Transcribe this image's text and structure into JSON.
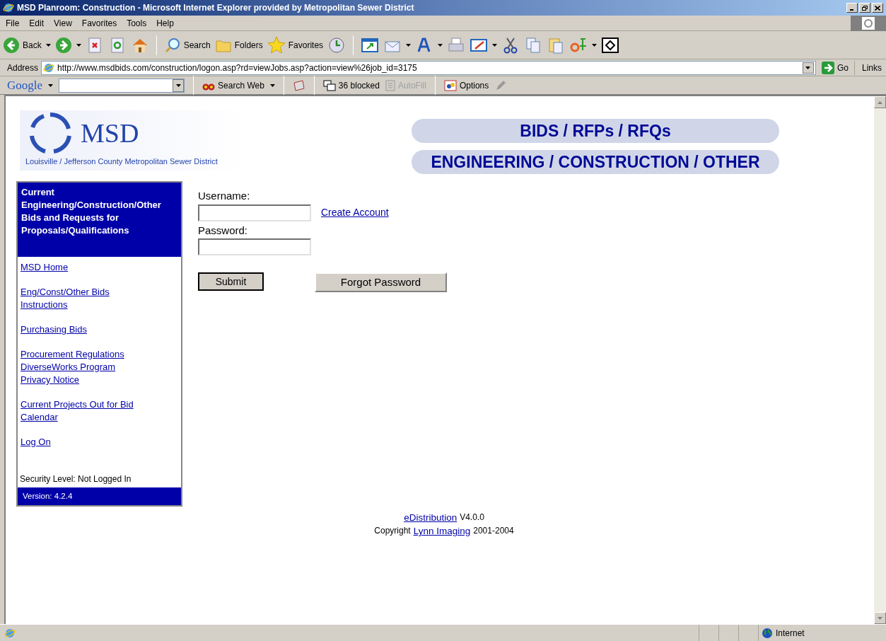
{
  "window": {
    "title": "MSD Planroom: Construction - Microsoft Internet Explorer provided by Metropolitan Sewer District"
  },
  "menu": [
    "File",
    "Edit",
    "View",
    "Favorites",
    "Tools",
    "Help"
  ],
  "toolbar": {
    "back": "Back",
    "search": "Search",
    "folders": "Folders",
    "favorites": "Favorites"
  },
  "address_bar": {
    "label": "Address",
    "url": "http://www.msdbids.com/construction/logon.asp?rd=viewJobs.asp?action=view%26job_id=3175",
    "go": "Go",
    "links": "Links"
  },
  "google_bar": {
    "logo": "Google",
    "search_web": "Search Web",
    "blocked": "36 blocked",
    "autofill": {
      "label": "AutoFill",
      "disabled": true
    },
    "options": "Options"
  },
  "page": {
    "logo": {
      "name": "MSD",
      "subtitle": "Louisville / Jefferson County Metropolitan Sewer District"
    },
    "banner": [
      "BIDS / RFPs / RFQs",
      "ENGINEERING / CONSTRUCTION / OTHER"
    ],
    "sidebar": {
      "heading": "Current Engineering/Construction/Other Bids and Requests for Proposals/Qualifications",
      "link_groups": [
        [
          "MSD Home"
        ],
        [
          "Eng/Const/Other Bids Instructions"
        ],
        [
          "Purchasing Bids"
        ],
        [
          "Procurement Regulations",
          "DiverseWorks Program",
          "Privacy Notice"
        ],
        [
          "Current Projects Out for Bid Calendar"
        ],
        [
          "Log On"
        ]
      ],
      "security": "Security Level: Not Logged In",
      "version": "Version: 4.2.4"
    },
    "form": {
      "username_label": "Username:",
      "password_label": "Password:",
      "create_account": "Create Account",
      "submit": "Submit",
      "forgot_password": "Forgot Password"
    },
    "footer": {
      "product_link": "eDistribution",
      "product_version": "V4.0.0",
      "copyright": "Copyright",
      "company_link": "Lynn Imaging",
      "years": "2001-2004"
    }
  },
  "status_bar": {
    "zone": "Internet"
  }
}
